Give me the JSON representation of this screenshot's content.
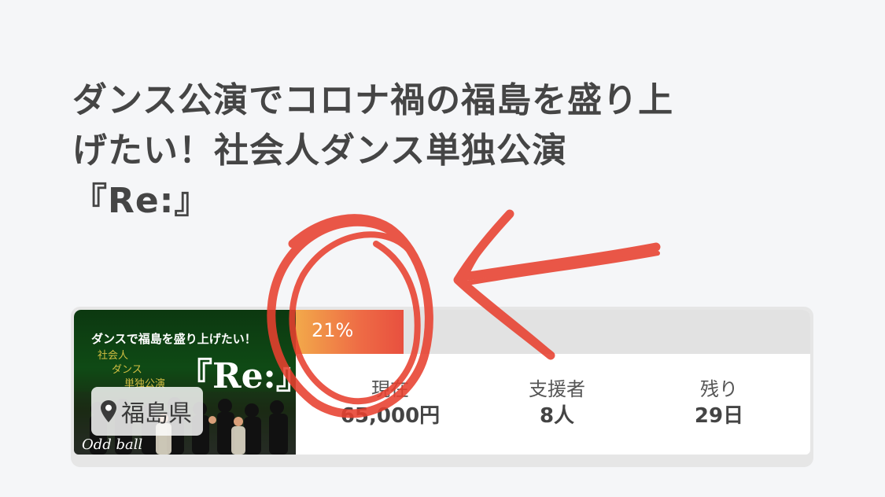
{
  "project": {
    "title_lines": [
      "ダンス公演でコロナ禍の福島を盛り上",
      "げたい！社会人ダンス単独公演",
      "『Re:』"
    ],
    "thumbnail": {
      "headline": "ダンスで福島を盛り上げたい！",
      "sub_lines": [
        "社会人",
        "ダンス",
        "単独公演"
      ],
      "logo": "『Re:』",
      "footer": "Odd ball"
    },
    "location": "福島県",
    "progress": {
      "percent": 21,
      "label": "21%"
    },
    "stats": [
      {
        "label": "現在",
        "value": "65,000円"
      },
      {
        "label": "支援者",
        "value": "8人"
      },
      {
        "label": "残り",
        "value": "29日"
      }
    ]
  },
  "colors": {
    "title": "#454545",
    "progress_start": "#f2a94a",
    "progress_end": "#e8503f",
    "annotation": "#e8402f"
  },
  "icons": [
    "map-pin-icon"
  ]
}
